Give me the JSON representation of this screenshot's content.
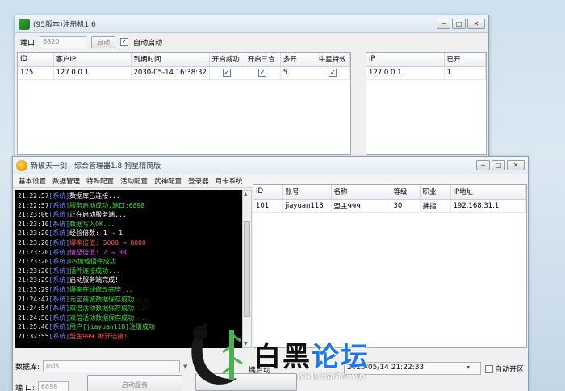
{
  "window1": {
    "title": "(95版本)注册机1.6",
    "port_label": "端口",
    "port_value": "8820",
    "start_label": "启动",
    "auto_start_label": "自动启动",
    "auto_start_check": "✓",
    "columns": [
      "ID",
      "客户IP",
      "到期时间",
      "开启威功",
      "开启三合",
      "多开",
      "牛星特效"
    ],
    "rows": [
      {
        "id": "175",
        "ip": "127.0.0.1",
        "expire": "2030-05-14 16:38:32",
        "c1": "✓",
        "c2": "✓",
        "multi": "5",
        "c3": "✓"
      }
    ],
    "side_columns": [
      "IP",
      "已开"
    ],
    "side_rows": [
      {
        "ip": "127.0.0.1",
        "count": "1"
      }
    ]
  },
  "window2": {
    "title": "新破天一剑 - 综合管理器1.8 狗星精简版",
    "menu": [
      "基本设置",
      "数据管理",
      "特殊配置",
      "活动配置",
      "武神配置",
      "登录器",
      "月卡系统"
    ],
    "log": [
      {
        "time": "21:22:57",
        "tag": "[系统]",
        "msg": "数据库已连接...",
        "color": "#ffffff"
      },
      {
        "time": "21:22:57",
        "tag": "[系统]",
        "msg": "服务启动成功,端口:6898",
        "color": "#2ee62e"
      },
      {
        "time": "21:23:06",
        "tag": "[系统]",
        "msg": "正在启动服务端...",
        "color": "#ffffff"
      },
      {
        "time": "21:23:10",
        "tag": "[系统]",
        "msg": "数据写入OK...",
        "color": "#2ee62e"
      },
      {
        "time": "21:23:20",
        "tag": "[系统]",
        "msg": "经验倍数: 1 → 1",
        "color": "#ffffff"
      },
      {
        "time": "21:23:20",
        "tag": "[系统]",
        "msg": "爆率倍值: 5000 → 8000",
        "color": "#ff4d4d"
      },
      {
        "time": "21:23:20",
        "tag": "[系统]",
        "msg": "情怒倍值: 2 → 30",
        "color": "#ff44ff"
      },
      {
        "time": "21:23:20",
        "tag": "[系统]",
        "msg": "GS加载插件成功",
        "color": "#2ee62e"
      },
      {
        "time": "21:23:20",
        "tag": "[系统]",
        "msg": "插件连接成功...",
        "color": "#2ee62e"
      },
      {
        "time": "21:23:29",
        "tag": "[系统]",
        "msg": "启动服务端完成!",
        "color": "#ffffff"
      },
      {
        "time": "21:23:29",
        "tag": "[系统]",
        "msg": "爆率在线修改完毕...",
        "color": "#2ee62e"
      },
      {
        "time": "21:24:47",
        "tag": "[系统]",
        "msg": "元宝商城数据保存成功...",
        "color": "#2ee62e"
      },
      {
        "time": "21:24:54",
        "tag": "[系统]",
        "msg": "双倍活动数据保存成功...",
        "color": "#2ee62e"
      },
      {
        "time": "21:24:56",
        "tag": "[系统]",
        "msg": "双倍活动数据保存成功...",
        "color": "#2ee62e"
      },
      {
        "time": "21:25:46",
        "tag": "[系统]",
        "msg": "用户[jiayuan118]注册成功",
        "color": "#2ee62e"
      },
      {
        "time": "21:32:55",
        "tag": "[系统]",
        "msg": "盟主999 断开连接!",
        "color": "#ff4d4d"
      }
    ],
    "columns": [
      "ID",
      "账号",
      "名称",
      "等级",
      "职业",
      "IP地址"
    ],
    "rows": [
      {
        "id": "101",
        "account": "jiayuan118",
        "name": "盟主999",
        "level": "30",
        "job": "拂指",
        "ip": "192.168.31.1"
      }
    ],
    "bottom": {
      "db_label": "数据库:",
      "db_value": "pcik",
      "port_label": "端 口:",
      "port_value": "6898",
      "start_service_label": "启动服务",
      "datetime": "2025/05/14 21:22:33",
      "auto_open_label": "自动开区",
      "timer_label": "键启动"
    }
  },
  "watermark": {
    "title_black": "白黑",
    "title_blue": "论坛",
    "url": "www.Baihei.vip"
  }
}
